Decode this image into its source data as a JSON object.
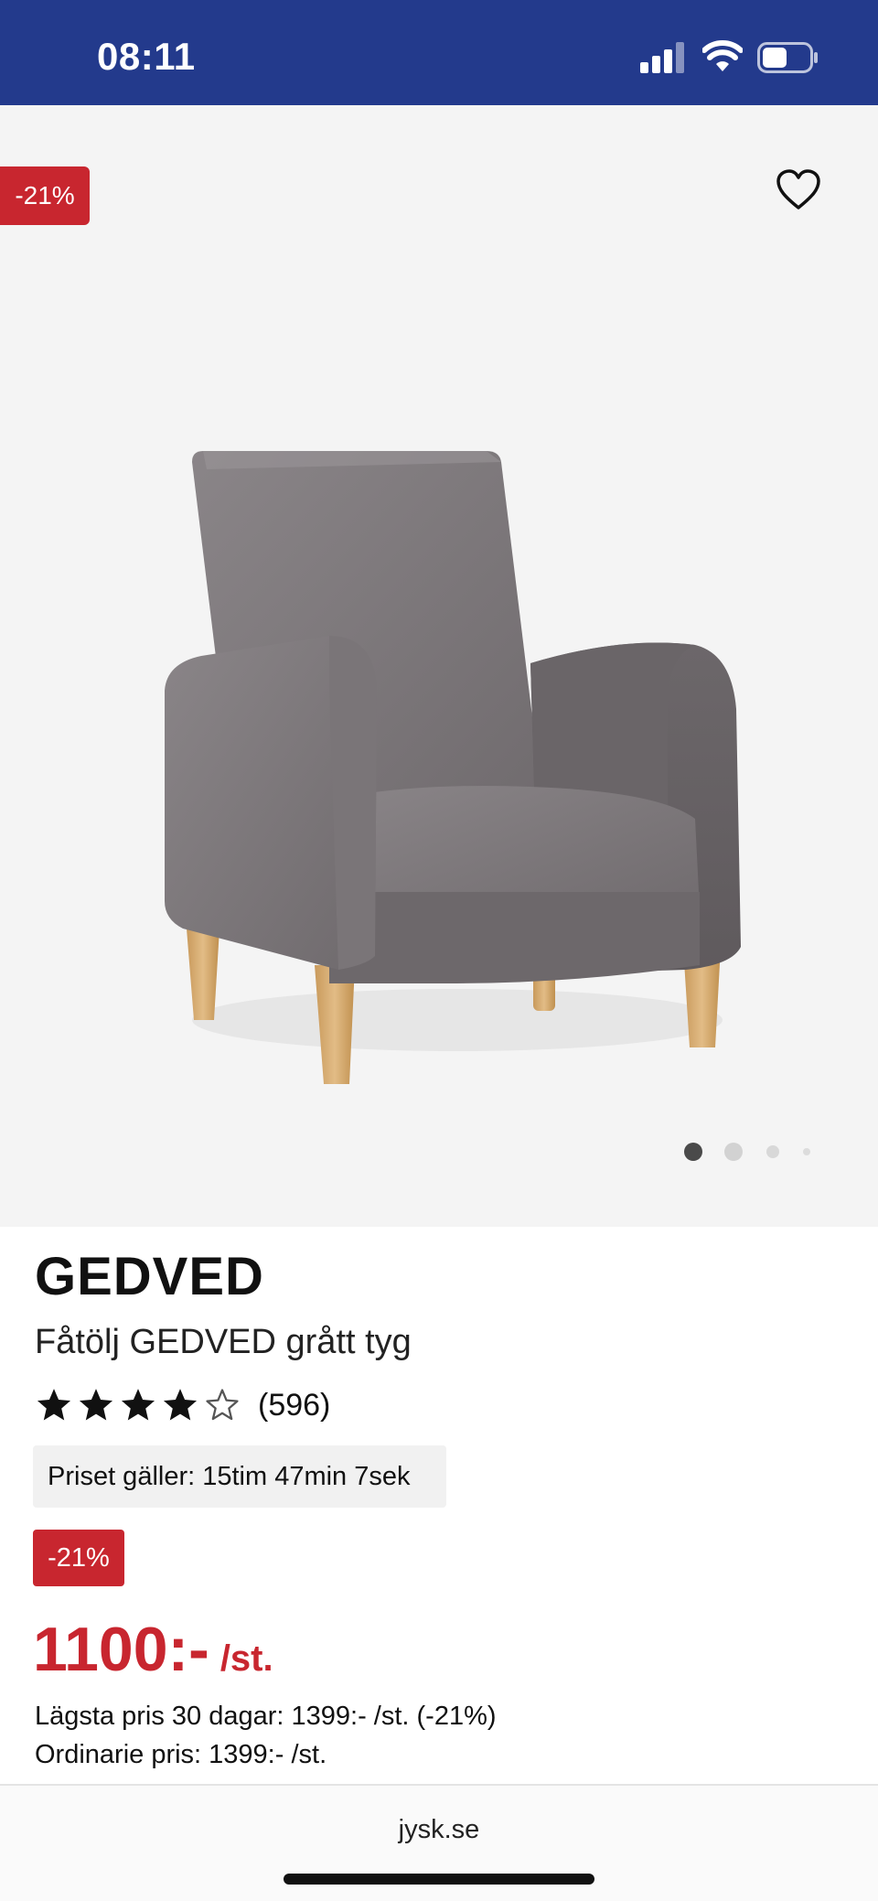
{
  "status_bar": {
    "time": "08:11",
    "background": "#233a8c"
  },
  "product_image": {
    "discount_label": "-21%",
    "favorite_icon": "heart-outline-icon",
    "carousel_pages": 4,
    "carousel_active_index": 0
  },
  "product": {
    "brand": "GEDVED",
    "title": "Fåtölj GEDVED grått tyg",
    "rating": 4,
    "rating_max": 5,
    "review_count": "(596)",
    "timer_text": "Priset gäller: 15tim 47min 7sek",
    "discount_badge": "-21%",
    "price": "1100:-",
    "unit": "/st.",
    "lowest_price_text": "Lägsta pris 30 dagar: 1399:- /st. (-21%)",
    "ordinary_price_text": "Ordinarie pris: 1399:- /st."
  },
  "browser": {
    "url": "jysk.se"
  },
  "colors": {
    "accent_red": "#c8262f",
    "brand_blue": "#233a8c"
  }
}
